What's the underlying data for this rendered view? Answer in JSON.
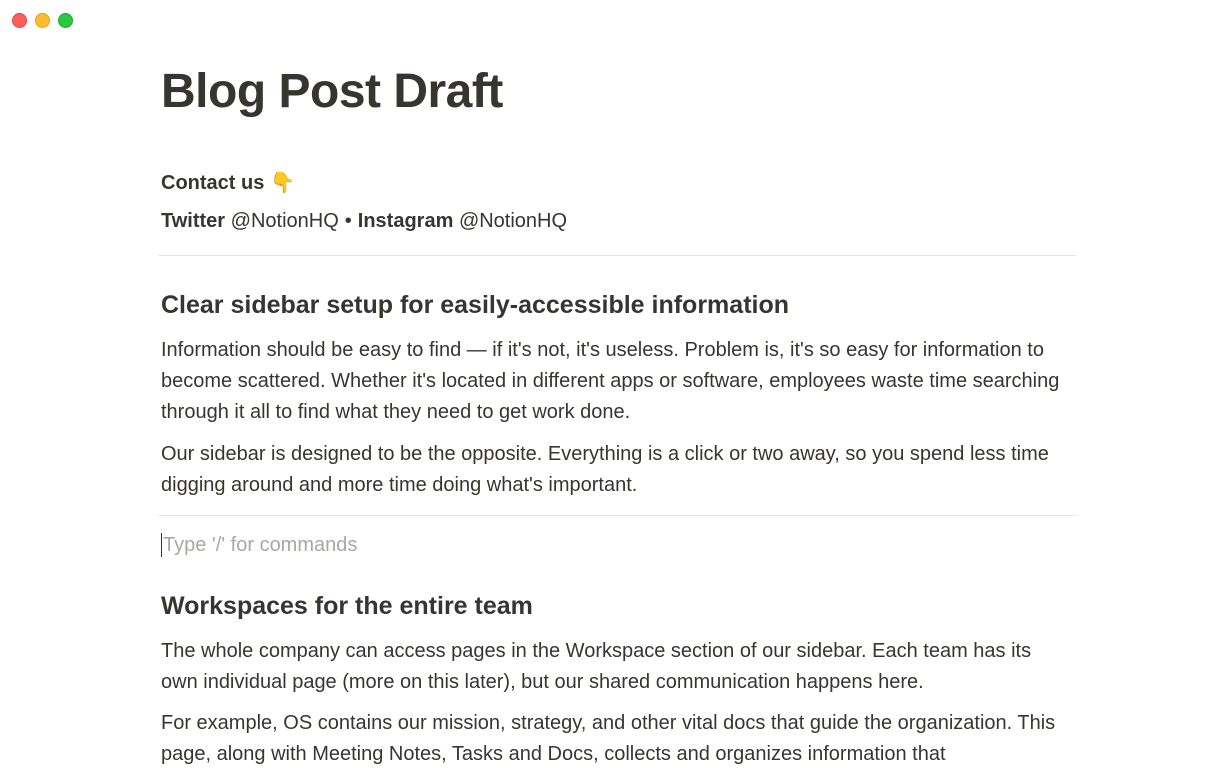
{
  "window": {
    "controls": [
      "close",
      "minimize",
      "maximize"
    ]
  },
  "page": {
    "title": "Blog Post Draft",
    "contact": {
      "label": "Contact us",
      "icon": "pointing-down-hand-icon",
      "glyph": "👇"
    },
    "social": {
      "twitter_label": "Twitter",
      "twitter_handle": "@NotionHQ",
      "separator": "•",
      "instagram_label": "Instagram",
      "instagram_handle": "@NotionHQ"
    },
    "sections": [
      {
        "heading": "Clear sidebar setup for easily-accessible information",
        "paragraphs": [
          "Information should be easy to find — if it's not, it's useless. Problem is, it's so easy for information to become scattered. Whether it's located in different apps or software, employees waste time searching through it all to find what they need to get work done.",
          "Our sidebar is designed to be the opposite. Everything is a click or two away, so you spend less time digging around and more time doing what's important."
        ]
      },
      {
        "heading": "Workspaces for the entire team",
        "paragraphs": [
          "The whole company can access pages in the Workspace section of our sidebar. Each team has its own individual page (more on this later), but our shared communication happens here.",
          "For example, OS contains our mission, strategy, and other vital docs that guide the organization. This page, along with Meeting Notes, Tasks and Docs, collects and organizes information that"
        ]
      }
    ],
    "editor_placeholder": "Type '/' for commands"
  },
  "colors": {
    "text": "#37352f",
    "placeholder": "#a8a7a3",
    "divider": "#e6e6e4",
    "close": "#ff5f57",
    "minimize": "#febc2e",
    "maximize": "#28c840"
  }
}
